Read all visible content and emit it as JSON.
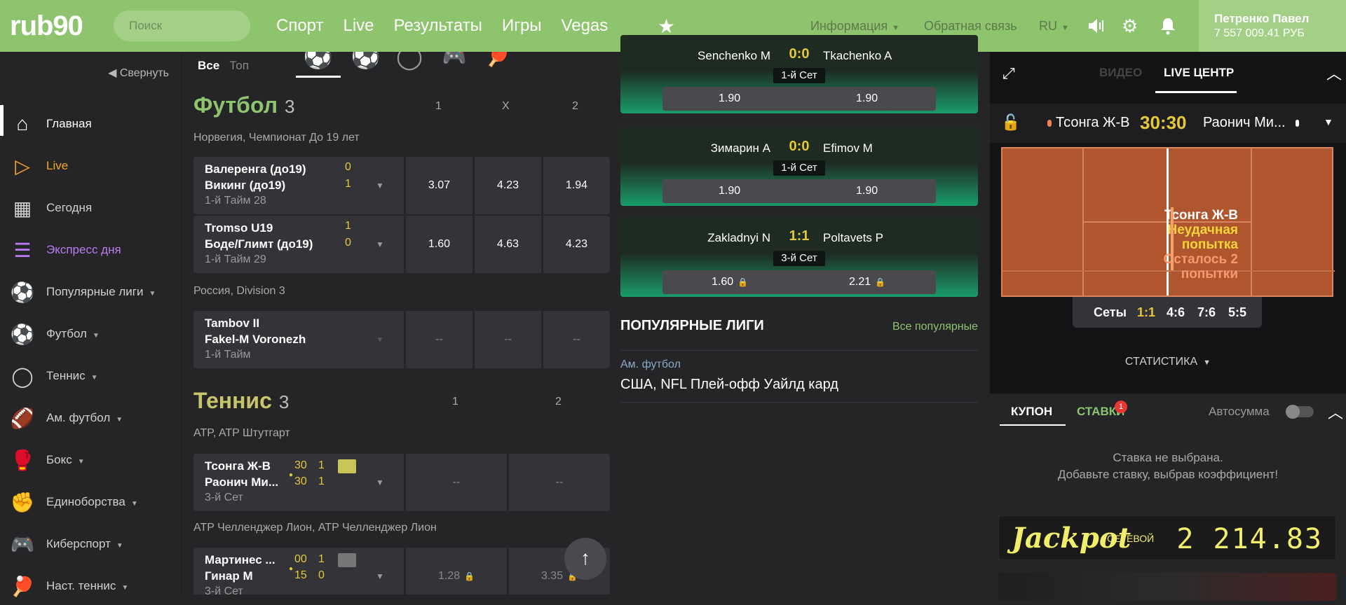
{
  "header": {
    "logo": "rub90",
    "search_placeholder": "Поиск",
    "nav": [
      "Спорт",
      "Live",
      "Результаты",
      "Игры",
      "Vegas"
    ],
    "info": "Информация",
    "feedback": "Обратная связь",
    "lang": "RU",
    "user_name": "Петренко Павел",
    "user_balance": "7 557 009.41 РУБ"
  },
  "sidebar": {
    "collapse": "Свернуть",
    "items": [
      {
        "label": "Главная",
        "icon": "home-icon",
        "color": "#ffffff"
      },
      {
        "label": "Live",
        "icon": "play-icon",
        "color": "#f5a623"
      },
      {
        "label": "Сегодня",
        "icon": "calendar-icon",
        "color": "#d0d0d0"
      },
      {
        "label": "Экспресс дня",
        "icon": "list-icon",
        "color": "#b97cf2"
      },
      {
        "label": "Популярные лиги",
        "icon": "trophy-icon",
        "color": "#d0d0d0"
      },
      {
        "label": "Футбол",
        "icon": "soccer-ball-icon",
        "color": "#d0d0d0"
      },
      {
        "label": "Теннис",
        "icon": "tennis-ball-icon",
        "color": "#d0d0d0"
      },
      {
        "label": "Ам. футбол",
        "icon": "american-football-icon",
        "color": "#d0d0d0"
      },
      {
        "label": "Бокс",
        "icon": "boxing-glove-icon",
        "color": "#d0d0d0"
      },
      {
        "label": "Единоборства",
        "icon": "fist-icon",
        "color": "#d0d0d0"
      },
      {
        "label": "Киберспорт",
        "icon": "gamepad-icon",
        "color": "#d0d0d0"
      },
      {
        "label": "Наст. теннис",
        "icon": "table-tennis-icon",
        "color": "#d0d0d0"
      }
    ]
  },
  "center": {
    "filter_all": "Все",
    "filter_top": "Топ",
    "football": {
      "title": "Футбол",
      "count": "3",
      "cols": [
        "1",
        "X",
        "2"
      ],
      "league1": "Норвегия, Чемпионат До 19 лет",
      "matches": [
        {
          "t1": "Валеренга (до19)",
          "t2": "Викинг (до19)",
          "s1": "0",
          "s2": "1",
          "status": "1-й Тайм 28",
          "odds": [
            "3.07",
            "4.23",
            "1.94"
          ]
        },
        {
          "t1": "Tromso U19",
          "t2": "Боде/Глимт (до19)",
          "s1": "1",
          "s2": "0",
          "status": "1-й Тайм 29",
          "odds": [
            "1.60",
            "4.63",
            "4.23"
          ]
        }
      ],
      "league2": "Россия, Division 3",
      "match3": {
        "t1": "Tambov II",
        "t2": "Fakel-M Voronezh",
        "status": "1-й Тайм",
        "odds": [
          "--",
          "--",
          "--"
        ]
      }
    },
    "tennis": {
      "title": "Теннис",
      "count": "3",
      "cols": [
        "1",
        "2"
      ],
      "league1": "ATP, ATP Штутгарт",
      "match1": {
        "t1": "Тсонга Ж-В",
        "t2": "Раонич Ми...",
        "p1": "30",
        "g1": "1",
        "p2": "30",
        "g2": "1",
        "status": "3-й Сет",
        "odds": [
          "--",
          "--"
        ]
      },
      "league2": "ATP Челленджер Лион, ATP Челленджер Лион",
      "match2": {
        "t1": "Мартинес ...",
        "t2": "Гинар М",
        "p1": "00",
        "g1": "1",
        "p2": "15",
        "g2": "0",
        "status": "3-й Сет",
        "odds": [
          "1.28",
          "3.35"
        ]
      }
    }
  },
  "live_cards": [
    {
      "p1": "Senchenko M",
      "score": "0:0",
      "p2": "Tkachenko A",
      "set": "1-й Сет",
      "o1": "1.90",
      "o2": "1.90"
    },
    {
      "p1": "Зимарин А",
      "score": "0:0",
      "p2": "Efimov M",
      "set": "1-й Сет",
      "o1": "1.90",
      "o2": "1.90"
    },
    {
      "p1": "Zakladnyi N",
      "score": "1:1",
      "p2": "Poltavets P",
      "set": "3-й Сет",
      "o1": "1.60",
      "o2": "2.21"
    }
  ],
  "popular": {
    "title": "ПОПУЛЯРНЫЕ ЛИГИ",
    "all": "Все популярные",
    "sport": "Ам. футбол",
    "league": "США, NFL Плей-офф Уайлд кард"
  },
  "right": {
    "tab_video": "ВИДЕО",
    "tab_live": "LIVE ЦЕНТР",
    "p1": "Тсонга Ж-В",
    "score": "30:30",
    "p2": "Раонич Ми...",
    "court_msg": [
      "Тсонга Ж-В",
      "Неудачная",
      "попытка",
      "Осталось 2",
      "попытки"
    ],
    "sets_label": "Сеты",
    "sets": [
      "1:1",
      "4:6",
      "7:6",
      "5:5"
    ],
    "stats": "СТАТИСТИКА",
    "coupon_tab": "КУПОН",
    "bets_tab": "СТАВКИ",
    "bets_badge": "1",
    "autosum": "Автосумма",
    "empty1": "Ставка не выбрана.",
    "empty2": "Добавьте ставку, выбрав коэффициент!",
    "jackpot": "Jackpot",
    "jackpot_sub": "СЕТЕВОЙ",
    "jackpot_value": "2 214.83"
  },
  "colors": {
    "accent": "#8ec46d",
    "score": "#e5c73a",
    "live": "#f5a623",
    "express": "#b97cf2"
  }
}
